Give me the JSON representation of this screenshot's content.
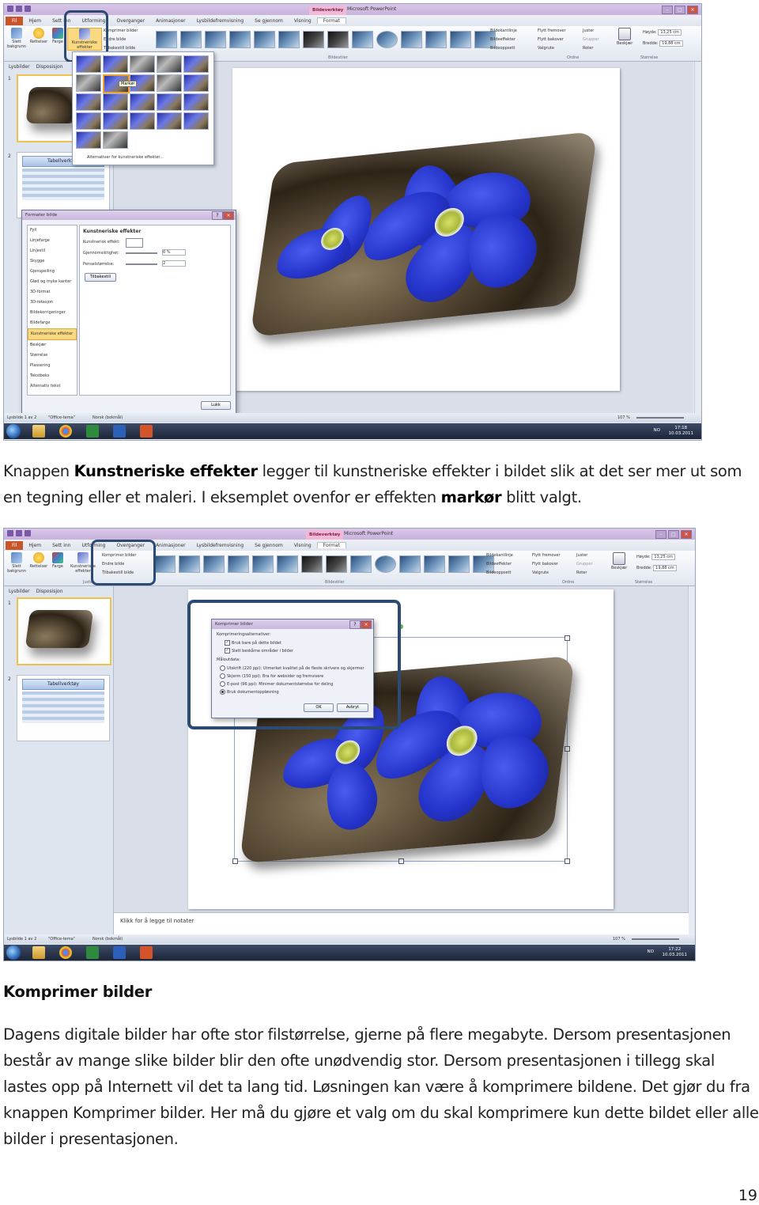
{
  "screenshot1": {
    "window_title": "Presentasjon1 - Microsoft PowerPoint",
    "context_tab": "Bildeverktøy",
    "tabs": [
      "Fil",
      "Hjem",
      "Sett inn",
      "Utforming",
      "Overganger",
      "Animasjoner",
      "Lysbildefremvisning",
      "Se gjennom",
      "Visning",
      "Format"
    ],
    "ribbon_left": [
      "Slett bakgrunn",
      "Rettelser",
      "Farge",
      "Kunstneriske effekter"
    ],
    "adjust_items": [
      "Komprimer bilder",
      "Endre bilde",
      "Tilbakestill bilde"
    ],
    "picture_border_items": [
      "Bildekantlinje",
      "Bildeeffekter",
      "Bildeoppsett"
    ],
    "arrange_items": [
      "Flytt fremover",
      "Flytt bakover",
      "Valgrute"
    ],
    "arrange_items2": [
      "Juster",
      "Grupper",
      "Roter"
    ],
    "group_labels": [
      "Bildestiler",
      "Ordne",
      "Størrelse"
    ],
    "crop_label": "Beskjær",
    "height_label": "Høyde:",
    "height_value": "13,25 cm",
    "width_label": "Bredde:",
    "width_value": "19,88 cm",
    "pane_tabs": [
      "Lysbilder",
      "Disposisjon"
    ],
    "thumb_numbers": [
      "1",
      "2"
    ],
    "table_thumb_title": "Tabellverktøy",
    "gallery_tooltip": "Markør",
    "gallery_footer": "Alternativer for kunstneriske effekter...",
    "dialog": {
      "title": "Formater bilde",
      "items": [
        "Fyll",
        "Linjefarge",
        "Linjestil",
        "Skygge",
        "Gjenspeiling",
        "Glød og myke kanter",
        "3D-format",
        "3D-rotasjon",
        "Bildekorrigeringer",
        "Bildefarge",
        "Kunstneriske effekter",
        "Beskjær",
        "Størrelse",
        "Plassering",
        "Tekstboks",
        "Alternativ tekst"
      ],
      "selected": "Kunstneriske effekter",
      "section": "Kunstneriske effekter",
      "field1": "Kunstnerisk effekt:",
      "field2": "Gjennomsiktighet:",
      "field2_value": "0 %",
      "field3": "Penselstørrelse:",
      "field3_value": "2",
      "reset": "Tilbakestill",
      "close": "Lukk"
    },
    "status_left": [
      "Lysbilde 1 av 2",
      "\"Office-tema\"",
      "Norsk (bokmål)"
    ],
    "zoom": "107 %",
    "tray_lang": "NO",
    "clock_time": "17:18",
    "clock_date": "10.03.2011"
  },
  "paragraph1": {
    "pre": "Knappen ",
    "b1": "Kunstneriske effekter",
    "mid": " legger til kunstneriske effekter i bildet slik at det ser mer ut som en tegning eller et maleri. I eksemplet ovenfor er effekten ",
    "b2": "markør",
    "post": " blitt valgt."
  },
  "screenshot2": {
    "window_title": "Presentasjon1 - Microsoft PowerPoint",
    "context_tab": "Bildeverktøy",
    "tabs": [
      "Fil",
      "Hjem",
      "Sett inn",
      "Utforming",
      "Overganger",
      "Animasjoner",
      "Lysbildefremvisning",
      "Se gjennom",
      "Visning",
      "Format"
    ],
    "ribbon_left": [
      "Slett bakgrunn",
      "Rettelser",
      "Farge",
      "Kunstneriske effekter"
    ],
    "adjust_items": [
      "Komprimer bilder",
      "Endre bilde",
      "Tilbakestill bilde"
    ],
    "adjust_label": "Juster",
    "picture_border_items": [
      "Bildekantlinje",
      "Bildeeffekter",
      "Bildeoppsett"
    ],
    "arrange_items": [
      "Flytt fremover",
      "Flytt bakover",
      "Valgrute"
    ],
    "arrange_items2": [
      "Juster",
      "Grupper",
      "Roter"
    ],
    "group_labels": [
      "Bildestiler",
      "Ordne",
      "Størrelse"
    ],
    "crop_label": "Beskjær",
    "height_label": "Høyde:",
    "height_value": "13,25 cm",
    "width_label": "Bredde:",
    "width_value": "19,88 cm",
    "pane_tabs": [
      "Lysbilder",
      "Disposisjon"
    ],
    "thumb_numbers": [
      "1",
      "2"
    ],
    "table_thumb_title": "Tabellverktøy",
    "dialog": {
      "title": "Komprimer bilder",
      "options_label": "Komprimeringsalternativer:",
      "check1": "Bruk bare på dette bildet",
      "check2": "Slett beskårne områder i bilder",
      "target_label": "Måloutdata:",
      "radios": [
        "Utskrift (220 ppi): Utmerket kvalitet på de fleste skrivere og skjermer",
        "Skjerm (150 ppi): Bra for websider og fremvisere",
        "E-post (96 ppi): Minimer dokumentstørrelse for deling",
        "Bruk dokumentoppløsning"
      ],
      "ok": "OK",
      "cancel": "Avbryt"
    },
    "notes": "Klikk for å legge til notater",
    "status_left": [
      "Lysbilde 1 av 2",
      "\"Office-tema\"",
      "Norsk (bokmål)"
    ],
    "zoom": "107 %",
    "tray_lang": "NO",
    "clock_time": "17:22",
    "clock_date": "10.03.2011"
  },
  "heading": "Komprimer bilder",
  "paragraph2": "Dagens digitale bilder har ofte stor filstørrelse, gjerne på flere megabyte. Dersom presentasjonen består av mange slike bilder blir den ofte unødvendig stor. Dersom presentasjonen i tillegg skal lastes opp på Internett vil det ta lang tid. Løsningen kan være å komprimere bildene. Det gjør du fra knappen Komprimer bilder. Her må du gjøre et valg om du skal komprimere kun dette bildet eller alle bilder i presentasjonen.",
  "page_number": "19",
  "colors": {
    "accent_file_tab": "#c8552a",
    "highlight_ring": "#2d4a73",
    "petal": "#2433c9",
    "selected_item": "#fbd981"
  }
}
